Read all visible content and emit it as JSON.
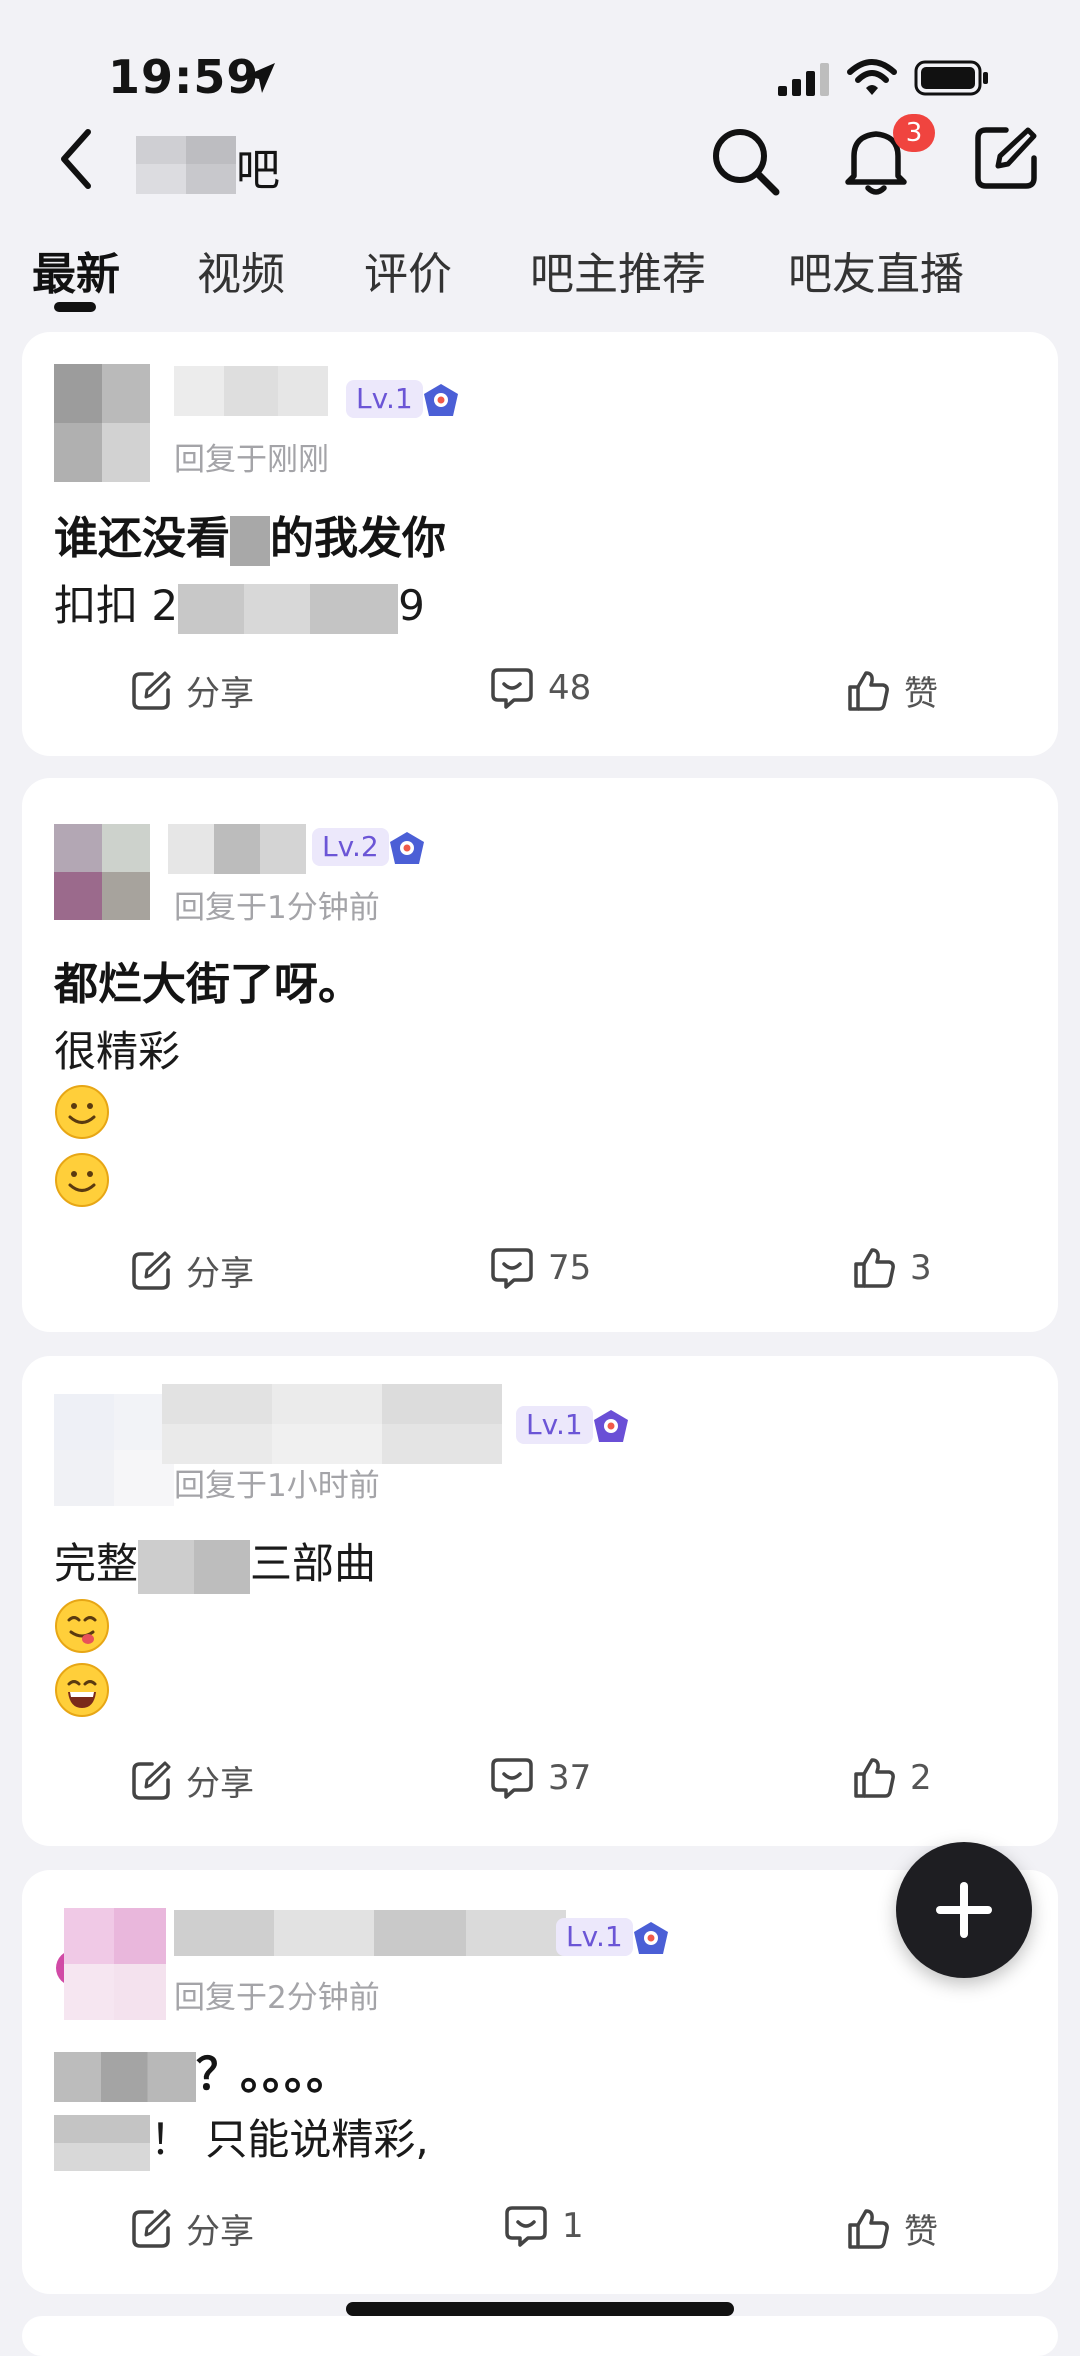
{
  "status_bar": {
    "time": "19:59"
  },
  "header": {
    "forum_suffix": "吧",
    "notification_count": "3"
  },
  "tabs": [
    {
      "label": "最新",
      "active": true
    },
    {
      "label": "视频",
      "active": false
    },
    {
      "label": "评价",
      "active": false
    },
    {
      "label": "吧主推荐",
      "active": false
    },
    {
      "label": "吧友直播",
      "active": false
    }
  ],
  "posts": [
    {
      "level": "Lv.1",
      "meta": "回复于刚刚",
      "title": "谁还没看",
      "title_after": "的我发你",
      "body_prefix": "扣扣 2",
      "body_suffix": "9",
      "share": "分享",
      "comments": "48",
      "likes": "赞"
    },
    {
      "level": "Lv.2",
      "meta": "回复于1分钟前",
      "title": "都烂大街了呀。",
      "body": "很精彩",
      "emojis": [
        "smile",
        "smile"
      ],
      "share": "分享",
      "comments": "75",
      "likes": "3"
    },
    {
      "level": "Lv.1",
      "meta": "回复于1小时前",
      "body_prefix": "完整",
      "body_suffix": "三部曲",
      "emojis": [
        "yum",
        "grin"
      ],
      "share": "分享",
      "comments": "37",
      "likes": "2"
    },
    {
      "level": "Lv.1",
      "meta": "回复于2分钟前",
      "title_after": "？。。。。",
      "body_after": "！ 只能说精彩,",
      "share": "分享",
      "comments": "1",
      "likes": "赞"
    }
  ],
  "icons": {
    "back": "chevron-left-icon",
    "search": "search-icon",
    "bell": "bell-icon",
    "compose": "compose-icon",
    "share": "share-icon",
    "comment": "comment-icon",
    "like": "thumbs-up-icon",
    "fab": "plus-icon"
  },
  "colors": {
    "accent_level": "#6b55d6",
    "badge": "#f0443f",
    "background": "#f2f2f6"
  }
}
